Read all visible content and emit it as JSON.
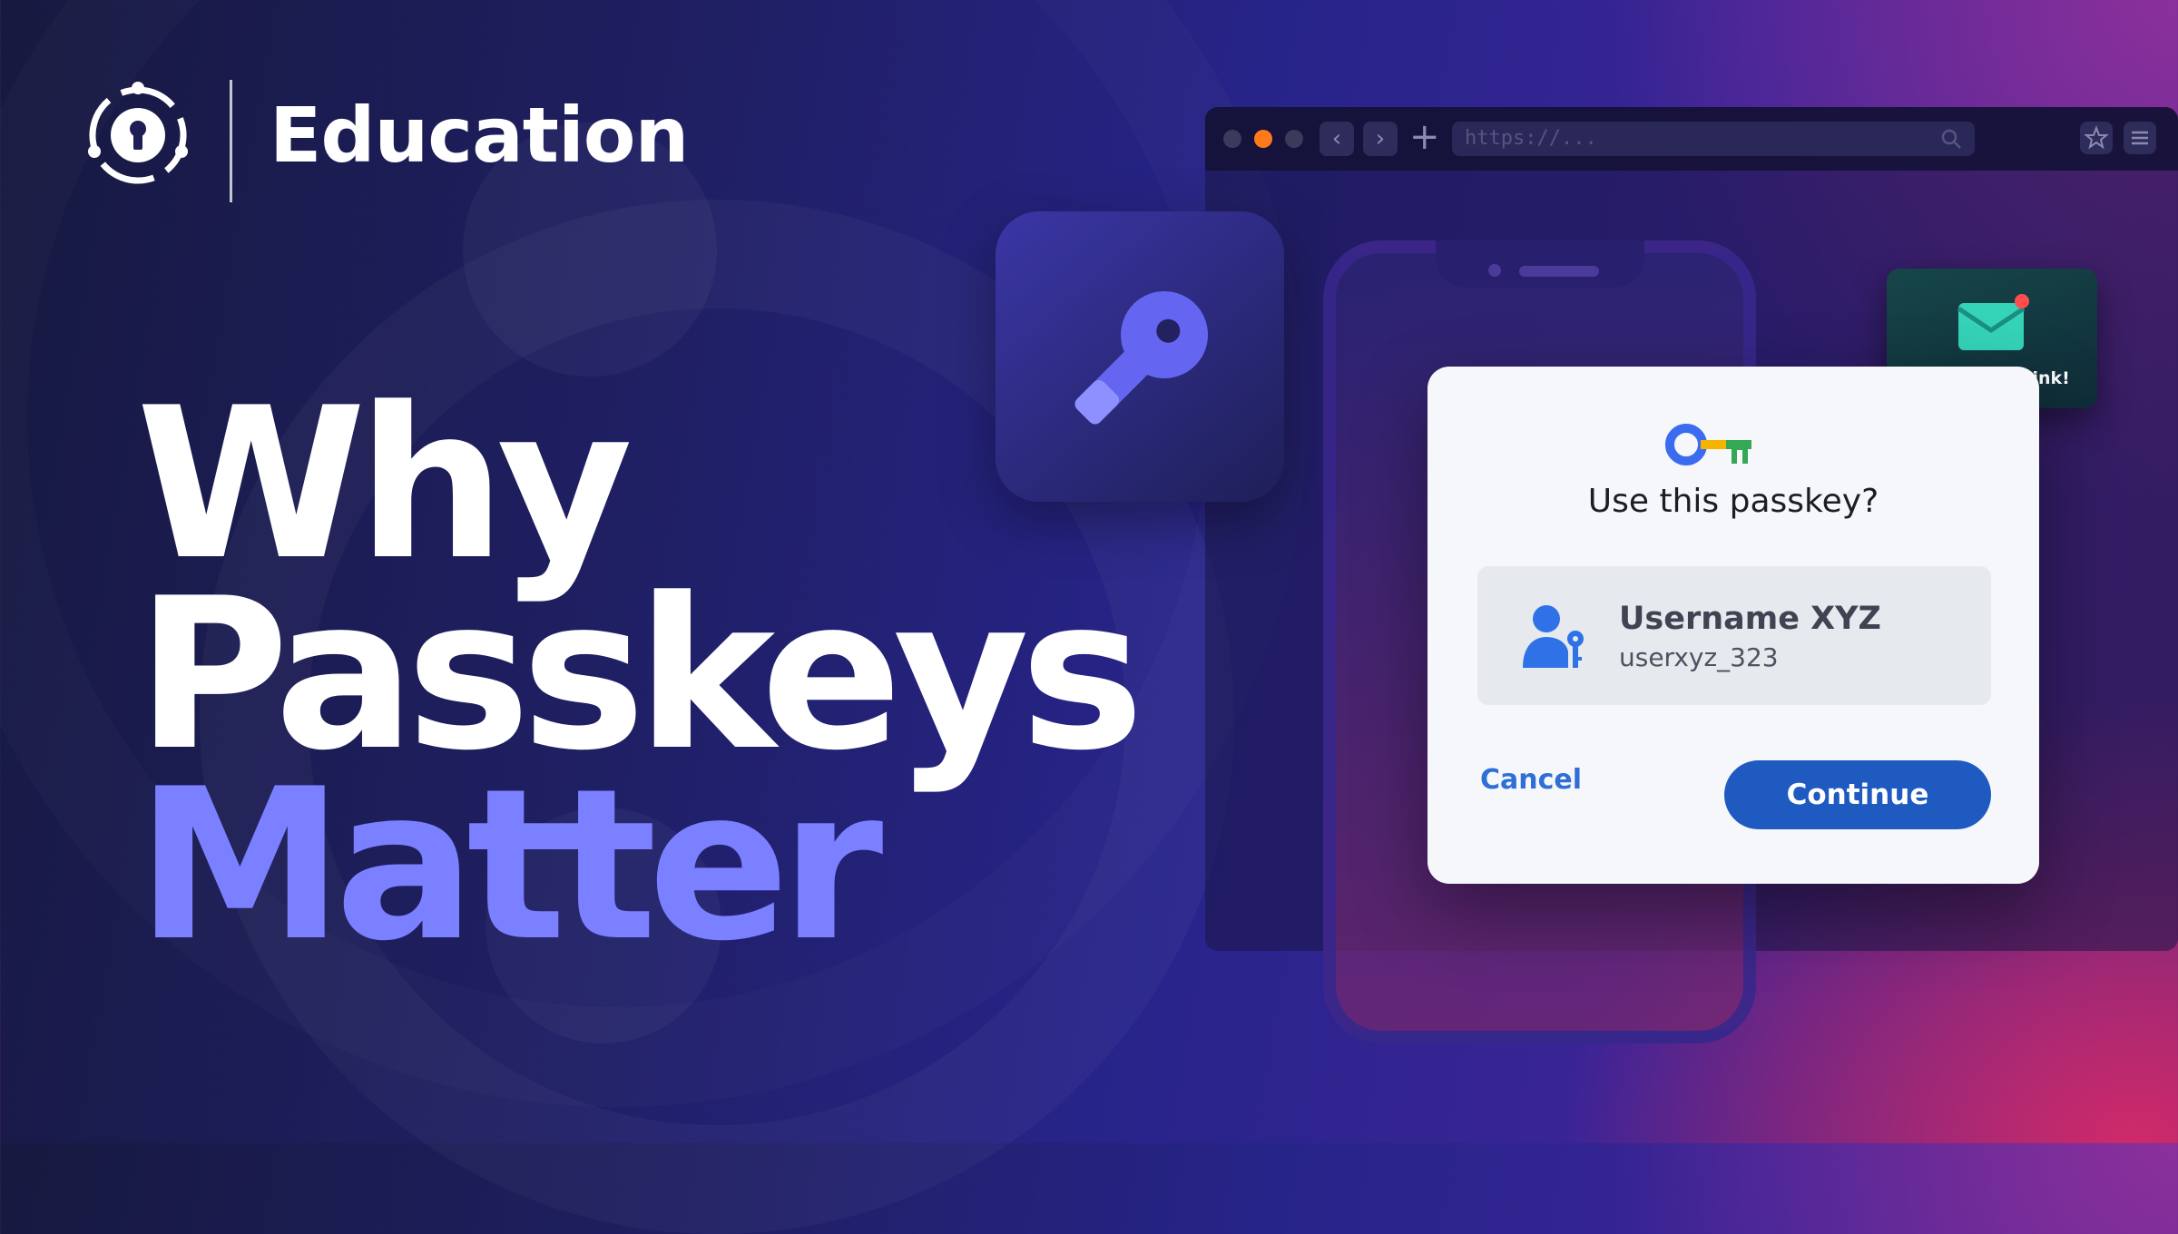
{
  "header": {
    "brand": "Education"
  },
  "headline": {
    "line1": "Why",
    "line2": "Passkeys",
    "line3": "Matter"
  },
  "browser": {
    "url_placeholder": "https://..."
  },
  "notification": {
    "label": "New Email Link!"
  },
  "dialog": {
    "title": "Use this passkey?",
    "account_name": "Username XYZ",
    "account_id": "userxyz_323",
    "cancel_label": "Cancel",
    "continue_label": "Continue"
  },
  "colors": {
    "accent_headline": "#7a80ff",
    "continue_button": "#1f5ac1",
    "cancel_text": "#2f6fd6",
    "browser_active_dot": "#ff7a1a"
  },
  "icons": [
    "passkey-logo-icon",
    "key-icon",
    "envelope-icon",
    "passkey-key-icon",
    "user-key-icon",
    "search-icon",
    "star-icon",
    "menu-icon",
    "back-icon",
    "forward-icon",
    "add-tab-icon"
  ]
}
